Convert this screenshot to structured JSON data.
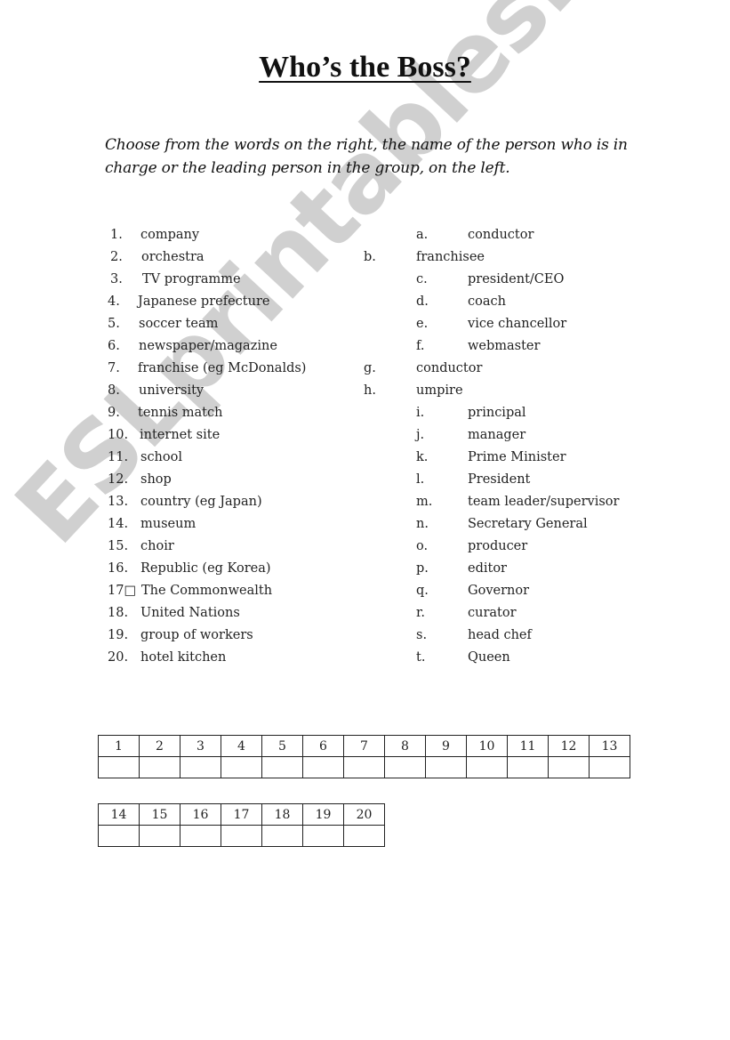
{
  "document": {
    "title": "Who’s the Boss?",
    "instructions": "Choose from the words on the right, the name of the person who is in charge or the leading person in the group, on the left.",
    "watermark": "ESLprintables.com"
  },
  "groups": [
    {
      "num": "1.",
      "term": "company"
    },
    {
      "num": "2.",
      "term": "orchestra"
    },
    {
      "num": "3.",
      "term": "TV programme"
    },
    {
      "num": "4.",
      "term": "Japanese prefecture"
    },
    {
      "num": "5.",
      "term": "soccer team"
    },
    {
      "num": "6.",
      "term": "newspaper/magazine"
    },
    {
      "num": "7.",
      "term": "franchise (eg McDonalds)"
    },
    {
      "num": "8.",
      "term": "university"
    },
    {
      "num": "9.",
      "term": "tennis match"
    },
    {
      "num": "10.",
      "term": "internet site"
    },
    {
      "num": "11.",
      "term": "school"
    },
    {
      "num": "12.",
      "term": "shop"
    },
    {
      "num": "13.",
      "term": "country (eg Japan)"
    },
    {
      "num": "14.",
      "term": "museum"
    },
    {
      "num": "15.",
      "term": "choir"
    },
    {
      "num": "16.",
      "term": "Republic (eg Korea)"
    },
    {
      "num": "17□",
      "term": "The Commonwealth"
    },
    {
      "num": "18.",
      "term": "United Nations"
    },
    {
      "num": "19.",
      "term": "group of workers"
    },
    {
      "num": "20.",
      "term": "hotel kitchen"
    }
  ],
  "leaders": [
    {
      "letter": "a.",
      "term": "conductor"
    },
    {
      "letter": "b.",
      "term": "franchisee"
    },
    {
      "letter": "c.",
      "term": "president/CEO"
    },
    {
      "letter": "d.",
      "term": "coach"
    },
    {
      "letter": "e.",
      "term": "vice chancellor"
    },
    {
      "letter": "f.",
      "term": "webmaster"
    },
    {
      "letter": "g.",
      "term": "conductor"
    },
    {
      "letter": "h.",
      "term": "umpire"
    },
    {
      "letter": "i.",
      "term": "principal"
    },
    {
      "letter": "j.",
      "term": "manager"
    },
    {
      "letter": "k.",
      "term": "Prime Minister"
    },
    {
      "letter": "l.",
      "term": "President"
    },
    {
      "letter": "m.",
      "term": "team leader/supervisor"
    },
    {
      "letter": "n.",
      "term": "Secretary General"
    },
    {
      "letter": "o.",
      "term": "producer"
    },
    {
      "letter": "p.",
      "term": "editor"
    },
    {
      "letter": "q.",
      "term": "Governor"
    },
    {
      "letter": "r.",
      "term": "curator"
    },
    {
      "letter": "s.",
      "term": "head chef"
    },
    {
      "letter": "t.",
      "term": "Queen"
    }
  ],
  "answer_grid": {
    "row1_headers": [
      "1",
      "2",
      "3",
      "4",
      "5",
      "6",
      "7",
      "8",
      "9",
      "10",
      "11",
      "12",
      "13"
    ],
    "row2_headers": [
      "14",
      "15",
      "16",
      "17",
      "18",
      "19",
      "20"
    ],
    "answers_row1": [
      "",
      "",
      "",
      "",
      "",
      "",
      "",
      "",
      "",
      "",
      "",
      "",
      ""
    ],
    "answers_row2": [
      "",
      "",
      "",
      "",
      "",
      "",
      ""
    ]
  }
}
